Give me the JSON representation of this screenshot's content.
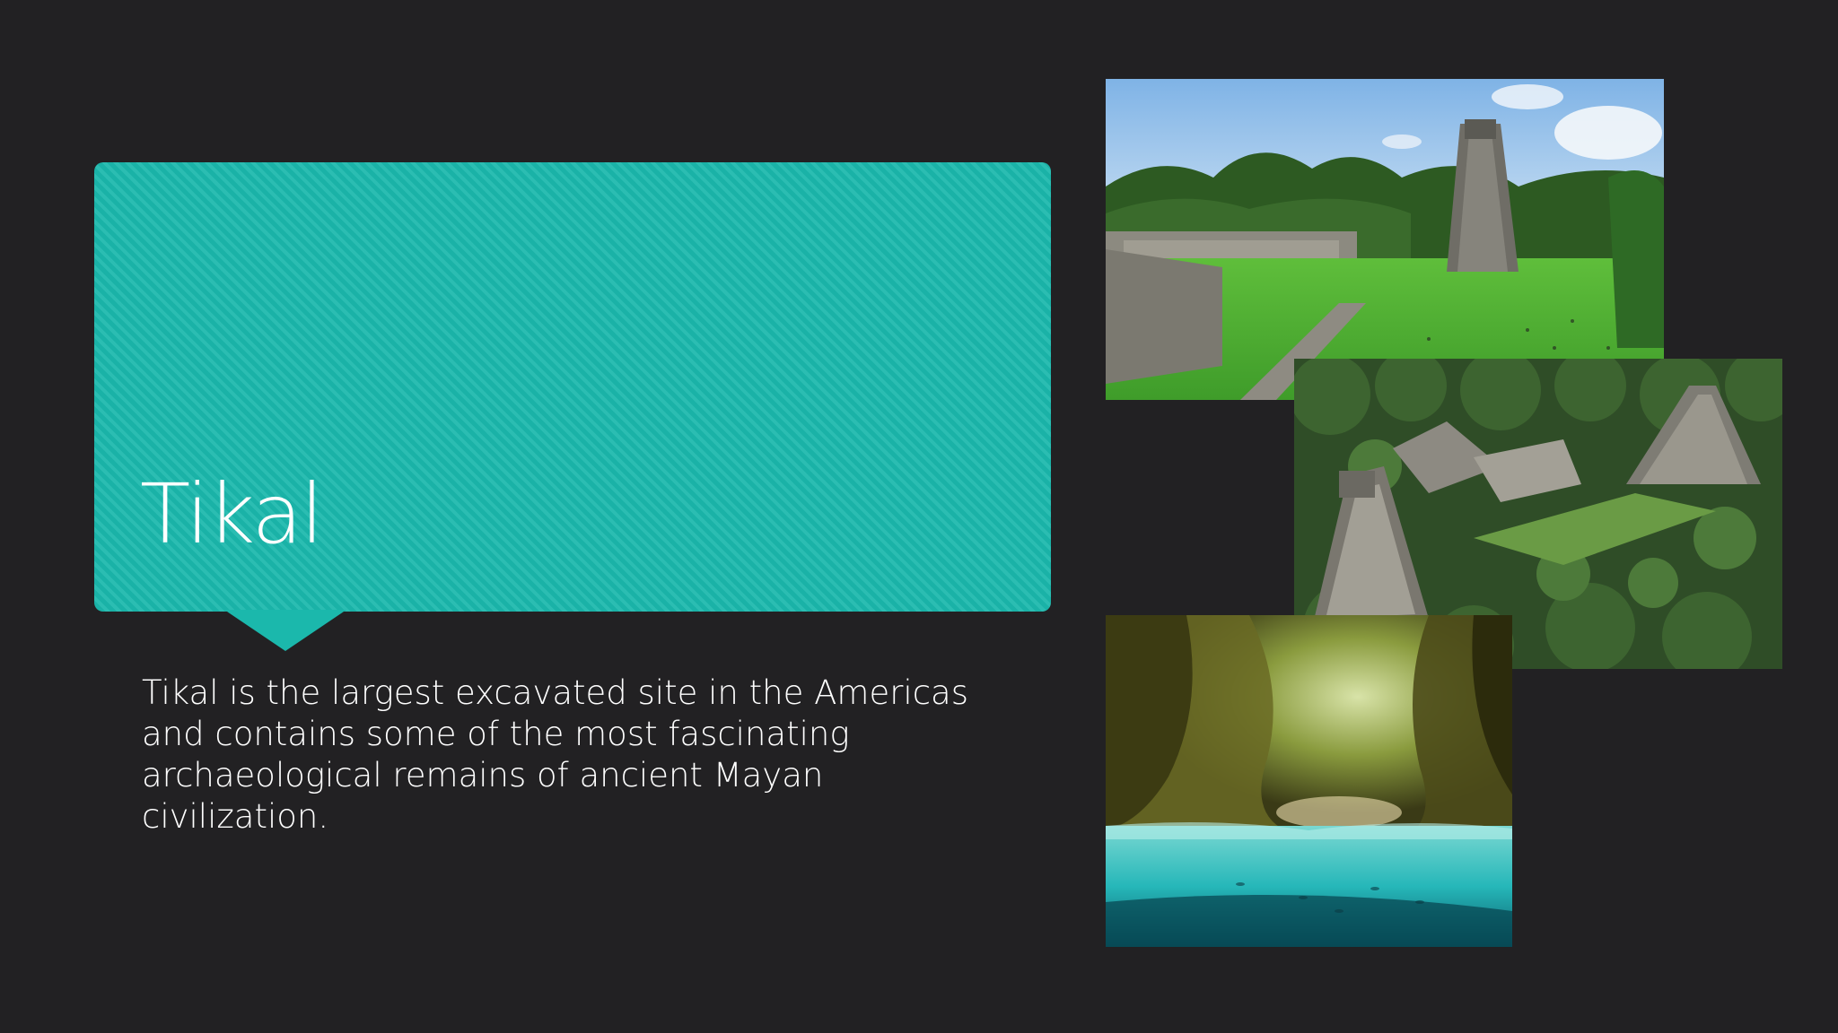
{
  "slide": {
    "title": "Tikal",
    "body": "Tikal is the largest excavated site in the Americas and contains some of the most fascinating archaeological remains of ancient Mayan civilization."
  },
  "colors": {
    "background": "#222123",
    "accent": "#1bb8ac",
    "text": "#ffffff"
  },
  "images": [
    {
      "name": "tikal-plaza-photo"
    },
    {
      "name": "tikal-aerial-photo"
    },
    {
      "name": "cenote-cave-photo"
    }
  ]
}
